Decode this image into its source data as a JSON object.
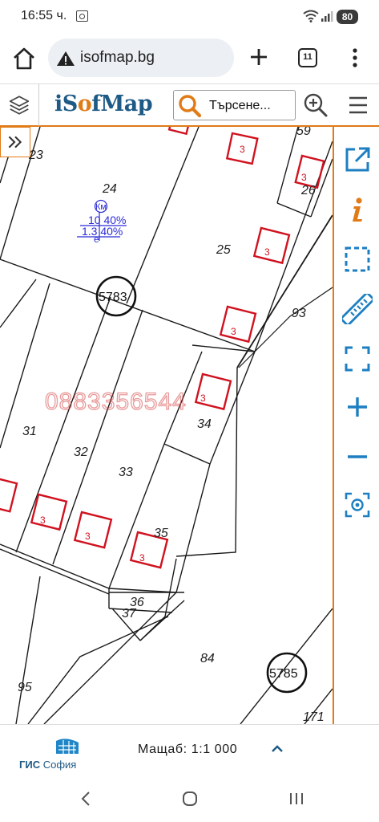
{
  "status_bar": {
    "time": "16:55 ч.",
    "battery": "80",
    "icons": [
      "screen-record-icon",
      "wifi-icon",
      "signal-icon",
      "battery-icon"
    ]
  },
  "browser": {
    "url": "isofmap.bg",
    "tab_count": "11",
    "icons": [
      "home-icon",
      "site-info-icon",
      "new-tab-icon",
      "tabs-icon",
      "more-vert-icon"
    ]
  },
  "app": {
    "logo_prefix": "i",
    "logo_accent": "S",
    "logo_o": "o",
    "logo_suffix": "f",
    "logo_map": "Map",
    "search_placeholder": "Търсене...",
    "brand_color": "#1d5a86",
    "accent_color": "#e07b17"
  },
  "map": {
    "watermark": "0883356544",
    "parcels": [
      {
        "id": "p23",
        "label": "23"
      },
      {
        "id": "p24",
        "label": "24"
      },
      {
        "id": "p25",
        "label": "25"
      },
      {
        "id": "p26",
        "label": "26"
      },
      {
        "id": "p59",
        "label": "59"
      },
      {
        "id": "p93",
        "label": "93"
      },
      {
        "id": "p31",
        "label": "31"
      },
      {
        "id": "p32",
        "label": "32"
      },
      {
        "id": "p33",
        "label": "33"
      },
      {
        "id": "p34",
        "label": "34"
      },
      {
        "id": "p35",
        "label": "35"
      },
      {
        "id": "p36",
        "label": "36"
      },
      {
        "id": "p37",
        "label": "37"
      },
      {
        "id": "p84",
        "label": "84"
      },
      {
        "id": "p95",
        "label": "95"
      },
      {
        "id": "p171",
        "label": "171"
      }
    ],
    "building_floor_label": "3",
    "blocks": [
      "5783",
      "5785"
    ],
    "annotation": {
      "top": "Км",
      "line1": "10 40%",
      "line2": "1.3 40%",
      "bottom": "е"
    },
    "building_color": "#d0121f"
  },
  "tools": [
    {
      "name": "external-link-icon"
    },
    {
      "name": "info-icon"
    },
    {
      "name": "select-area-icon"
    },
    {
      "name": "ruler-icon"
    },
    {
      "name": "fullscreen-icon"
    },
    {
      "name": "zoom-in-icon"
    },
    {
      "name": "zoom-out-icon"
    },
    {
      "name": "locate-icon"
    }
  ],
  "footer": {
    "gis_bold": "ГИС",
    "gis_rest": " София",
    "scale": "Мащаб: 1:1 000"
  }
}
